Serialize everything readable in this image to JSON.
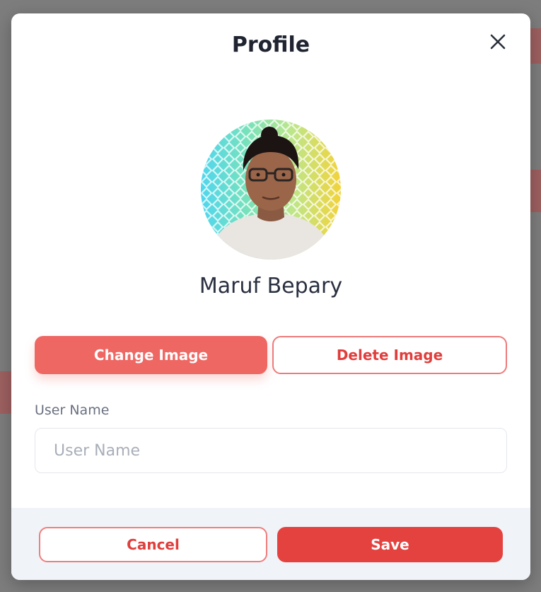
{
  "modal": {
    "title": "Profile"
  },
  "profile": {
    "display_name": "Maruf Bepary"
  },
  "image_actions": {
    "change_label": "Change Image",
    "delete_label": "Delete Image"
  },
  "form": {
    "username_label": "User Name",
    "username_placeholder": "User Name",
    "username_value": ""
  },
  "footer": {
    "cancel_label": "Cancel",
    "save_label": "Save"
  },
  "icons": {
    "close": "close-icon",
    "avatar": "profile-photo"
  },
  "colors": {
    "primary": "#e4423f",
    "primary_light": "#ef6763",
    "danger_text": "#e03e3c",
    "footer_bg": "#f0f3f7",
    "title_text": "#1f2430"
  }
}
